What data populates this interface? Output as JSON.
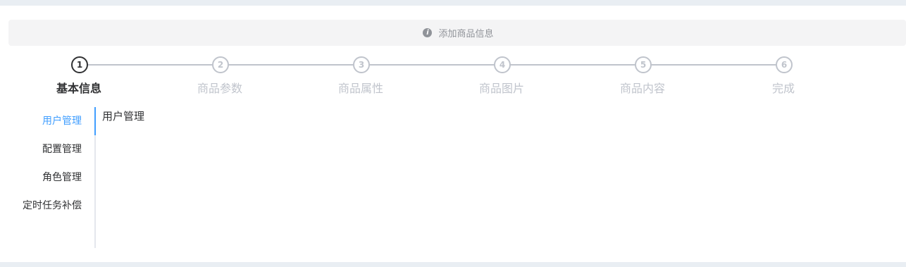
{
  "alert": {
    "text": "添加商品信息",
    "icon": "info-icon"
  },
  "steps": [
    {
      "num": "1",
      "title": "基本信息",
      "status": "active"
    },
    {
      "num": "2",
      "title": "商品参数",
      "status": "wait"
    },
    {
      "num": "3",
      "title": "商品属性",
      "status": "wait"
    },
    {
      "num": "4",
      "title": "商品图片",
      "status": "wait"
    },
    {
      "num": "5",
      "title": "商品内容",
      "status": "wait"
    },
    {
      "num": "6",
      "title": "完成",
      "status": "wait"
    }
  ],
  "tabs": {
    "items": [
      {
        "label": "用户管理",
        "active": true
      },
      {
        "label": "配置管理",
        "active": false
      },
      {
        "label": "角色管理",
        "active": false
      },
      {
        "label": "定时任务补偿",
        "active": false
      }
    ],
    "content": "用户管理"
  },
  "colors": {
    "accent": "#409eff",
    "active_step": "#303133",
    "inactive": "#c0c4cc"
  }
}
